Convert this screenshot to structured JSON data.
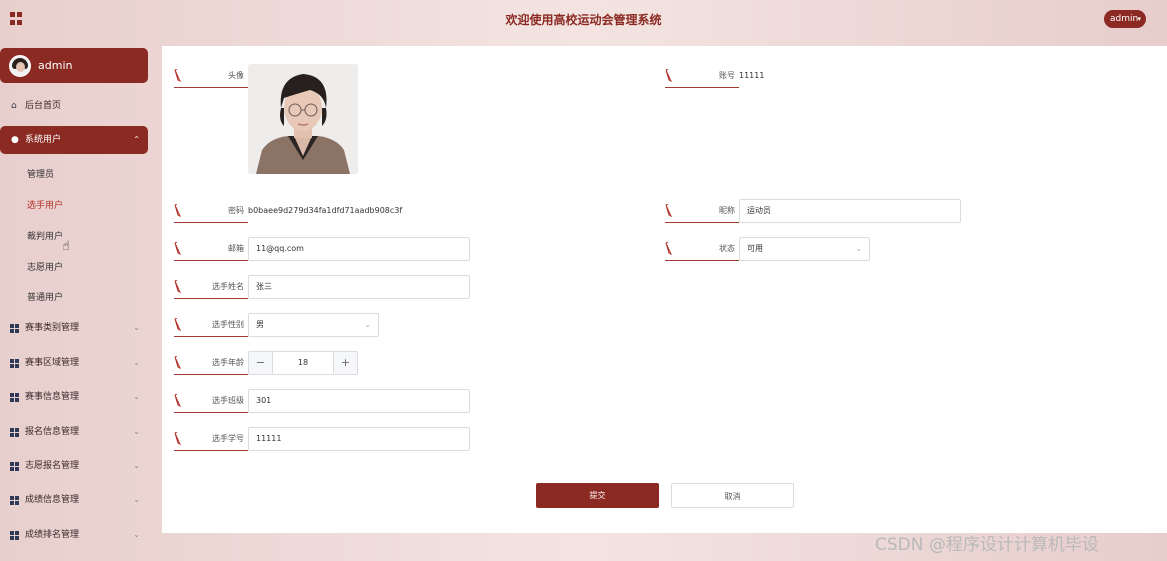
{
  "header": {
    "title": "欢迎使用高校运动会管理系统",
    "user_menu_label": "admin"
  },
  "sidebar": {
    "profile_name": "admin",
    "home_label": "后台首页",
    "system_users": {
      "label": "系统用户",
      "children": [
        "管理员",
        "选手用户",
        "裁判用户",
        "志愿用户",
        "普通用户"
      ],
      "selected": "选手用户"
    },
    "menus": [
      "赛事类别管理",
      "赛事区域管理",
      "赛事信息管理",
      "报名信息管理",
      "志愿报名管理",
      "成绩信息管理",
      "成绩排名管理"
    ]
  },
  "form": {
    "avatar": {
      "label": "头像"
    },
    "account": {
      "label": "账号",
      "value": "11111"
    },
    "password": {
      "label": "密码",
      "value": "b0baee9d279d34fa1dfd71aadb908c3f"
    },
    "nickname": {
      "label": "昵称",
      "value": "运动员"
    },
    "email": {
      "label": "邮箱",
      "value": "11@qq.com"
    },
    "status": {
      "label": "状态",
      "value": "可用"
    },
    "name": {
      "label": "选手姓名",
      "value": "张三"
    },
    "gender": {
      "label": "选手性别",
      "value": "男"
    },
    "age": {
      "label": "选手年龄",
      "value": "18",
      "minus": "−",
      "plus": "+"
    },
    "class_field": {
      "label": "选手班级",
      "value": "301"
    },
    "student_id": {
      "label": "选手学号",
      "value": "11111"
    },
    "submit_label": "提交",
    "cancel_label": "取消"
  },
  "watermark": "CSDN @程序设计计算机毕设",
  "colors": {
    "accent": "#8b2a22",
    "background": "#f3e4e2",
    "link": "#b1322a"
  },
  "icons": {
    "pen": "pen-icon",
    "home": "home-icon",
    "user": "user-icon",
    "grid": "grid-icon",
    "chevron": "chevron-down-icon"
  }
}
